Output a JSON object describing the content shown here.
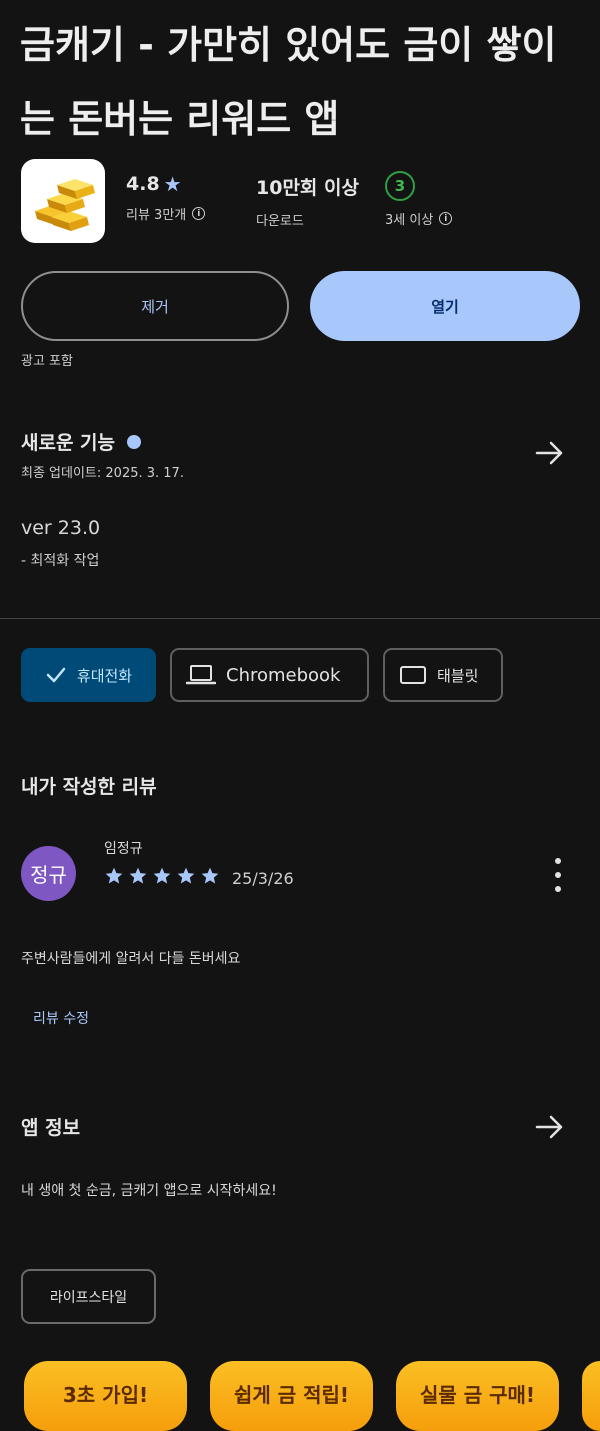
{
  "app": {
    "title": "금캐기 - 가만히 있어도 금이 쌓이는 돈버는 리워드 앱",
    "icon": "gold-bars-icon"
  },
  "stats": {
    "rating": "4.8",
    "rating_sub": "리뷰 3만개",
    "downloads": "10만회 이상",
    "downloads_sub": "다운로드",
    "age_badge": "3",
    "age_sub": "3세 이상"
  },
  "actions": {
    "uninstall_label": "제거",
    "open_label": "열기",
    "ads_note": "광고 포함"
  },
  "whats_new": {
    "title": "새로운 기능",
    "updated": "최종 업데이트: 2025. 3. 17.",
    "version": "ver 23.0",
    "note": "- 최적화 작업"
  },
  "devices": [
    {
      "label": "휴대전화",
      "selected": true,
      "icon": "check-icon"
    },
    {
      "label": "Chromebook",
      "selected": false,
      "icon": "laptop-icon"
    },
    {
      "label": "태블릿",
      "selected": false,
      "icon": "tablet-icon"
    }
  ],
  "my_review": {
    "section_title": "내가 작성한 리뷰",
    "avatar_text": "정규",
    "avatar_color": "#7e57c2",
    "author": "임정규",
    "stars": 5,
    "date": "25/3/26",
    "text": "주변사람들에게 알려서 다들 돈버세요",
    "edit_label": "리뷰 수정"
  },
  "app_info": {
    "title": "앱 정보",
    "description": "내 생애 첫 순금, 금캐기 앱으로 시작하세요!",
    "category": "라이프스타일"
  },
  "promos": [
    {
      "label": "3초 가입!"
    },
    {
      "label": "쉽게 금 적립!"
    },
    {
      "label": "실물 금 구매!"
    }
  ],
  "colors": {
    "accent": "#a8c7fa",
    "star": "#a8c7fa",
    "background": "#131313",
    "selected_chip": "#004a77",
    "age_badge": "#3fb950"
  }
}
